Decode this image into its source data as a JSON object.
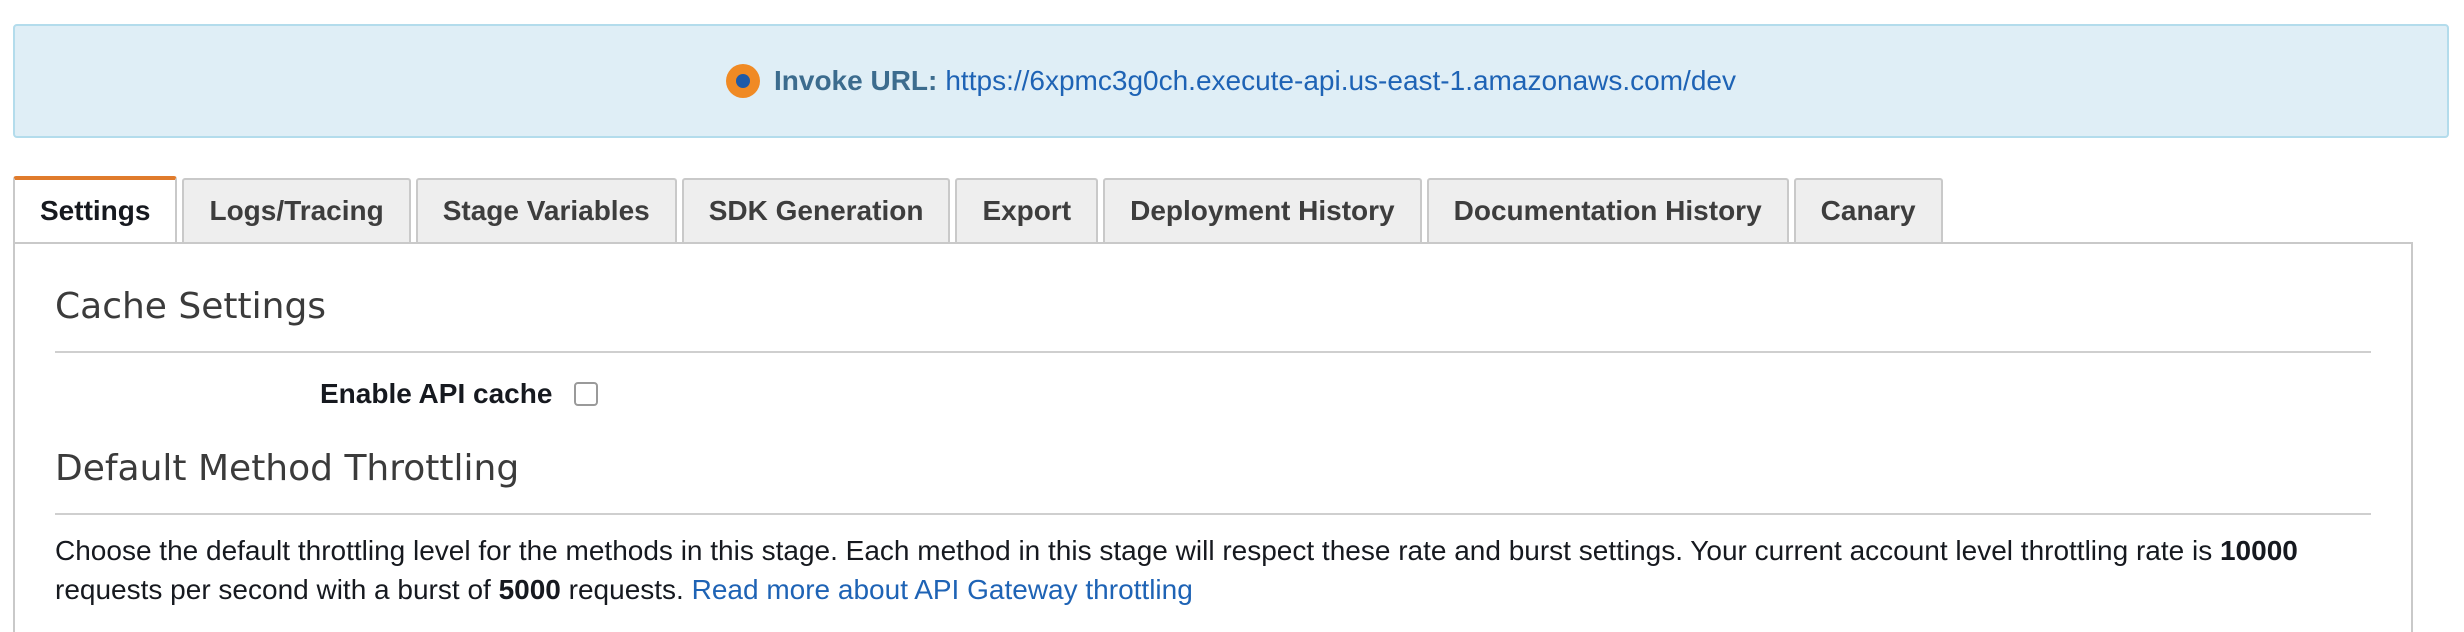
{
  "banner": {
    "label": "Invoke URL:",
    "url": "https://6xpmc3g0ch.execute-api.us-east-1.amazonaws.com/dev",
    "icon": "info-icon"
  },
  "tabs": [
    {
      "label": "Settings",
      "active": true
    },
    {
      "label": "Logs/Tracing",
      "active": false
    },
    {
      "label": "Stage Variables",
      "active": false
    },
    {
      "label": "SDK Generation",
      "active": false
    },
    {
      "label": "Export",
      "active": false
    },
    {
      "label": "Deployment History",
      "active": false
    },
    {
      "label": "Documentation History",
      "active": false
    },
    {
      "label": "Canary",
      "active": false
    }
  ],
  "cache": {
    "title": "Cache Settings",
    "enable_label": "Enable API cache",
    "enabled": false
  },
  "throttling": {
    "title": "Default Method Throttling",
    "text_1": "Choose the default throttling level for the methods in this stage. Each method in this stage will respect these rate and burst settings. Your current account level throttling rate is ",
    "rate": "10000",
    "text_2": "requests per second with a burst of ",
    "burst": "5000",
    "text_3": " requests. ",
    "link": "Read more about API Gateway throttling"
  },
  "colors": {
    "accent": "#e07b2c",
    "link": "#1e63b5",
    "banner_bg": "#dfeef6"
  }
}
